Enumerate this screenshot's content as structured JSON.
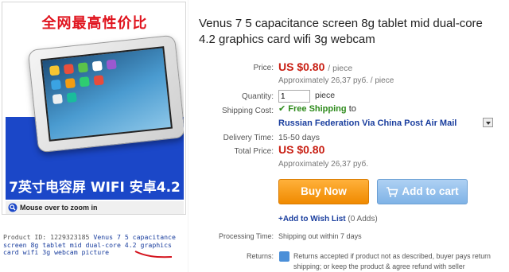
{
  "product_image": {
    "promo_top": "全网最高性价比",
    "promo_bottom": "7英寸电容屏 WIFI 安卓4.2",
    "zoom_hint": "Mouse over to zoom in",
    "zoom_icon": "magnifier-icon"
  },
  "product_id": {
    "label": "Product ID: 1229323185",
    "link_text": "Venus 7 5 capacitance screen 8g tablet mid dual-core 4.2 graphics card wifi 3g webcam picture"
  },
  "title": "Venus 7 5 capacitance screen 8g tablet mid dual-core 4.2 graphics card wifi 3g webcam",
  "price": {
    "label": "Price:",
    "amount": "US $0.80",
    "unit": "/ piece",
    "approx": "Approximately 26,37 руб. / piece"
  },
  "quantity": {
    "label": "Quantity:",
    "value": "1",
    "unit": "piece"
  },
  "shipping": {
    "label": "Shipping Cost:",
    "check_icon": "checkmark-icon",
    "free_label": "Free Shipping",
    "to": "to",
    "destination": "Russian Federation Via China Post Air Mail",
    "dropdown_icon": "chevron-down-icon"
  },
  "delivery": {
    "label": "Delivery Time:",
    "value": "15-50 days"
  },
  "total": {
    "label": "Total Price:",
    "amount": "US $0.80",
    "approx": "Approximately 26,37 руб."
  },
  "actions": {
    "buy_now": "Buy Now",
    "add_to_cart": "Add to cart",
    "cart_icon": "shopping-cart-icon"
  },
  "wishlist": {
    "link": "+Add to Wish List",
    "count": "(0 Adds)"
  },
  "processing": {
    "label": "Processing Time:",
    "value": "Shipping out within 7 days"
  },
  "returns": {
    "label": "Returns:",
    "icon": "return-policy-icon",
    "text": "Returns accepted if product not as described, buyer pays return shipping; or keep the product & agree refund with seller"
  },
  "colors": {
    "price_red": "#c81e12",
    "link_blue": "#1a3e9e",
    "free_green": "#2c8a1a",
    "buy_orange": "#f08a00",
    "cart_blue": "#7fb3e6"
  }
}
